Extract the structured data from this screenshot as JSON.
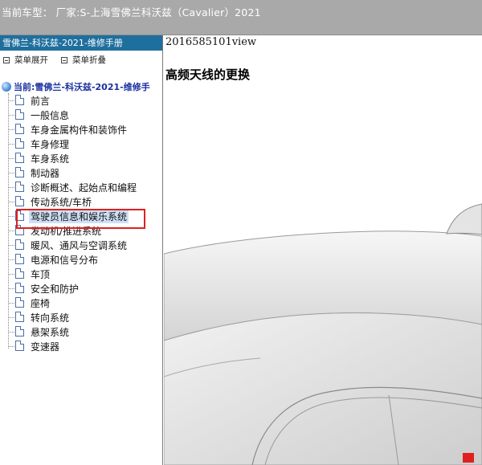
{
  "topbar": {
    "title": "当前车型： 厂家:S-上海雪佛兰科沃兹（Cavalier）2021"
  },
  "sidebar": {
    "header": "雪佛兰-科沃兹-2021-维修手册",
    "toolbar": {
      "expand_label": "菜单展开",
      "collapse_label": "菜单折叠"
    },
    "tree": {
      "root_label": "当前:雪佛兰-科沃兹-2021-维修手",
      "items": [
        {
          "label": "前言"
        },
        {
          "label": "一般信息"
        },
        {
          "label": "车身金属构件和装饰件"
        },
        {
          "label": "车身修理"
        },
        {
          "label": "车身系统"
        },
        {
          "label": "制动器"
        },
        {
          "label": "诊断概述、起始点和编程"
        },
        {
          "label": "传动系统/车桥"
        },
        {
          "label": "驾驶员信息和娱乐系统"
        },
        {
          "label": "发动机/推进系统"
        },
        {
          "label": "暖风、通风与空调系统"
        },
        {
          "label": "电源和信号分布"
        },
        {
          "label": "车顶"
        },
        {
          "label": "安全和防护"
        },
        {
          "label": "座椅"
        },
        {
          "label": "转向系统"
        },
        {
          "label": "悬架系统"
        },
        {
          "label": "变速器"
        }
      ],
      "selected_index": 8
    }
  },
  "content": {
    "doc_id": "2016585101view",
    "heading": "高频天线的更换",
    "accent_color": "#e02020"
  }
}
